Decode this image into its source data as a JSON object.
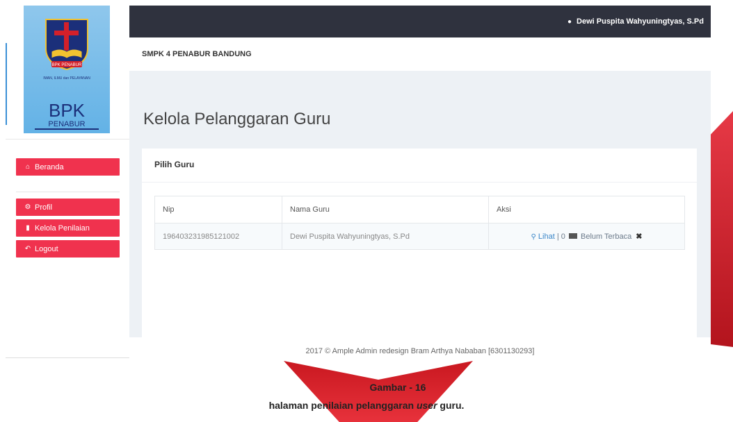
{
  "app": {
    "school_name": "SMPK 4 PENABUR BANDUNG",
    "user_name": "Dewi Puspita Wahyuningtyas, S.Pd"
  },
  "logo": {
    "badge_text": "BPK PENABUR",
    "motto": "IMAN, ILMU dan PELAYANAN",
    "title": "BPK",
    "subtitle": "PENABUR"
  },
  "sidebar": {
    "items": [
      {
        "label": "Beranda",
        "icon": "home-icon"
      },
      {
        "label": "Profil",
        "icon": "gear-icon"
      },
      {
        "label": "Kelola Penilaian",
        "icon": "document-icon"
      },
      {
        "label": "Logout",
        "icon": "reply-icon"
      }
    ]
  },
  "main": {
    "page_title": "Kelola Pelanggaran Guru",
    "card_title": "Pilih Guru",
    "table": {
      "headers": [
        "Nip",
        "Nama Guru",
        "Aksi"
      ],
      "rows": [
        {
          "nip": "196403231985121002",
          "nama": "Dewi Puspita Wahyuningtyas, S.Pd",
          "view_label": "Lihat",
          "separator": "|",
          "count": "0",
          "status": "Belum Terbaca"
        }
      ]
    }
  },
  "footer": {
    "text": "2017 © Ample Admin redesign Bram Arthya Nababan [6301130293]"
  },
  "caption": {
    "line1": "Gambar  - 16",
    "line2_prefix": "halaman penilaian pelanggaran ",
    "line2_italic": "user",
    "line2_suffix": " guru."
  },
  "colors": {
    "accent": "#f0324e",
    "topbar": "#2f323e",
    "content_bg": "#edf1f5",
    "link": "#3a86c8"
  }
}
